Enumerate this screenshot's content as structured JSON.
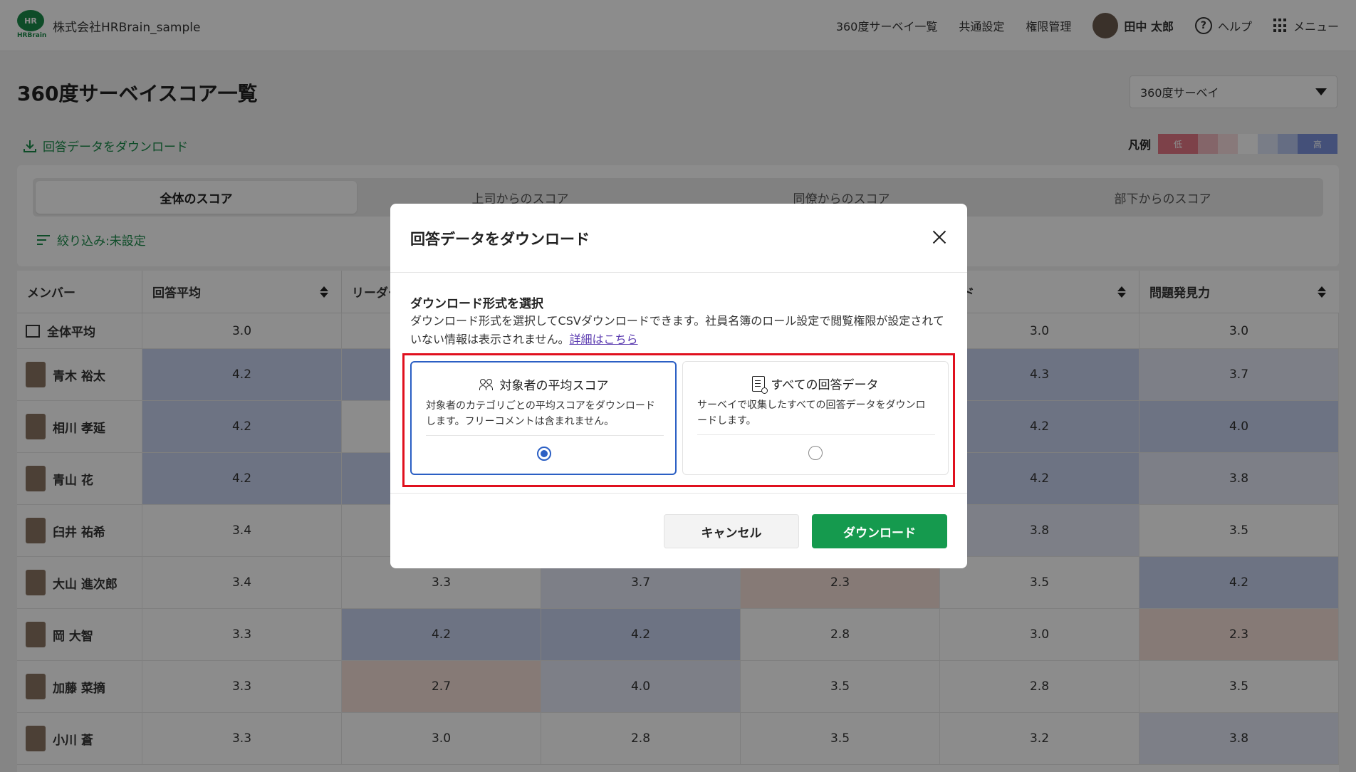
{
  "header": {
    "logo_top": "HR",
    "logo_bottom": "HRBrain",
    "company": "株式会社HRBrain_sample",
    "nav": [
      "360度サーベイ一覧",
      "共通設定",
      "権限管理"
    ],
    "user_name": "田中 太郎",
    "help_label": "ヘルプ",
    "help_glyph": "?",
    "menu_label": "メニュー"
  },
  "page": {
    "title": "360度サーベイスコア一覧",
    "survey_select_value": "360度サーベイ",
    "download_link": "回答データをダウンロード",
    "legend_label": "凡例",
    "legend_low": "低",
    "legend_high": "高",
    "tabs": [
      "全体のスコア",
      "上司からのスコア",
      "同僚からのスコア",
      "部下からのスコア"
    ],
    "filter": "絞り込み:未設定"
  },
  "table": {
    "headers": [
      "メンバー",
      "回答平均",
      "リーダー",
      "",
      "",
      "ード",
      "問題発見力"
    ],
    "rows": [
      {
        "name": "全体平均",
        "cols": [
          "3.0",
          "",
          "",
          "",
          "3.0",
          "3.0"
        ]
      },
      {
        "name": "青木 裕太",
        "cols": [
          "4.2",
          "",
          "",
          "",
          "4.3",
          "3.7"
        ]
      },
      {
        "name": "相川 孝延",
        "cols": [
          "4.2",
          "",
          "",
          "",
          "4.2",
          "4.0"
        ]
      },
      {
        "name": "青山 花",
        "cols": [
          "4.2",
          "",
          "",
          "",
          "4.2",
          "3.8"
        ]
      },
      {
        "name": "臼井 祐希",
        "cols": [
          "3.4",
          "",
          "",
          "",
          "3.8",
          "3.5"
        ]
      },
      {
        "name": "大山 進次郎",
        "cols": [
          "3.4",
          "3.3",
          "3.7",
          "2.3",
          "3.5",
          "4.2"
        ]
      },
      {
        "name": "岡 大智",
        "cols": [
          "3.3",
          "4.2",
          "4.2",
          "2.8",
          "3.0",
          "2.3"
        ]
      },
      {
        "name": "加藤 菜摘",
        "cols": [
          "3.3",
          "2.7",
          "4.0",
          "3.5",
          "2.8",
          "3.5"
        ]
      },
      {
        "name": "小川 蒼",
        "cols": [
          "3.3",
          "3.0",
          "2.8",
          "3.5",
          "3.2",
          "3.8"
        ]
      }
    ]
  },
  "modal": {
    "title": "回答データをダウンロード",
    "section_heading": "ダウンロード形式を選択",
    "section_desc": "ダウンロード形式を選択してCSVダウンロードできます。社員名簿のロール設定で閲覧権限が設定されていない情報は表示されません。",
    "detail_link": "詳細はこちら",
    "options": [
      {
        "title": "対象者の平均スコア",
        "desc": "対象者のカテゴリごとの平均スコアをダウンロードします。フリーコメントは含まれません。",
        "selected": true,
        "icon": "people-icon"
      },
      {
        "title": "すべての回答データ",
        "desc": "サーベイで収集したすべての回答データをダウンロードします。",
        "selected": false,
        "icon": "document-search-icon"
      }
    ],
    "cancel_label": "キャンセル",
    "download_label": "ダウンロード"
  },
  "colors": {
    "accent_green": "#159a4e",
    "highlight_red": "#e0101e",
    "selected_blue": "#2b5fc4"
  }
}
